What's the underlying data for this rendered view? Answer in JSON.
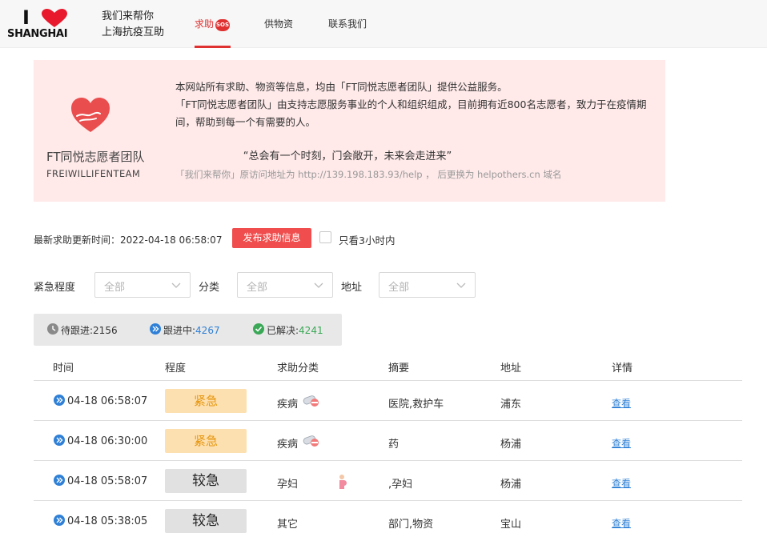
{
  "colors": {
    "accent": "#e03131",
    "notice_bg": "#ffe9e9",
    "urgent_bg": "#fde0b0",
    "urgent_fg": "#e6960e",
    "medium_bg": "#e1e1e1",
    "link": "#2f80d6",
    "resolved": "#3aa856"
  },
  "header": {
    "logo": {
      "top": "I",
      "bottom": "SHANGHAI"
    },
    "brand_line1": "我们来帮你",
    "brand_line2": "上海抗疫互助",
    "nav": {
      "help": "求助",
      "help_badge": "SOS",
      "supplies": "供物资",
      "contact": "联系我们"
    }
  },
  "notice": {
    "team_name": "FT同悦志愿者团队",
    "team_en": "FREIWILLIFENTEAM",
    "line1": "本网站所有求助、物资等信息，均由「FT同悦志愿者团队」提供公益服务。",
    "line2": "「FT同悦志愿者团队」由支持志愿服务事业的个人和组织组成，目前拥有近800名志愿者，致力于在疫情期间，帮助到每一个有需要的人。",
    "slogan": "“总会有一个时刻，门会敞开，未来会走进来”",
    "url_note": "「我们来帮你」原访问地址为 http://139.198.183.93/help ， 后更换为 helpothers.cn 域名"
  },
  "toolbar": {
    "update_label": "最新求助更新时间：2022-04-18 06:58:07",
    "publish_button": "发布求助信息",
    "only_3h_label": "只看3小时内",
    "only_3h_checked": false
  },
  "filters": {
    "urgency_label": "紧急程度",
    "urgency_value": "全部",
    "category_label": "分类",
    "category_value": "全部",
    "address_label": "地址",
    "address_value": "全部"
  },
  "stats": {
    "pending_label": "待跟进:",
    "pending_count": "2156",
    "following_label": "跟进中:",
    "following_count": "4267",
    "resolved_label": "已解决:",
    "resolved_count": "4241"
  },
  "table": {
    "headers": [
      "时间",
      "程度",
      "求助分类",
      "摘要",
      "地址",
      "详情"
    ],
    "rows": [
      {
        "time": "04-18 06:58:07",
        "level": "紧急",
        "level_type": "urgent",
        "category": "疾病",
        "category_icon": "pills-icon",
        "summary": "医院,救护车",
        "address": "浦东",
        "link": "查看"
      },
      {
        "time": "04-18 06:30:00",
        "level": "紧急",
        "level_type": "urgent",
        "category": "疾病",
        "category_icon": "pills-icon",
        "summary": "药",
        "address": "杨浦",
        "link": "查看"
      },
      {
        "time": "04-18 05:58:07",
        "level": "较急",
        "level_type": "medium",
        "category": "孕妇",
        "category_icon": "pregnant-icon",
        "summary": ",孕妇",
        "address": "杨浦",
        "link": "查看"
      },
      {
        "time": "04-18 05:38:05",
        "level": "较急",
        "level_type": "medium",
        "category": "其它",
        "category_icon": "",
        "summary": "部门,物资",
        "address": "宝山",
        "link": "查看"
      }
    ]
  }
}
